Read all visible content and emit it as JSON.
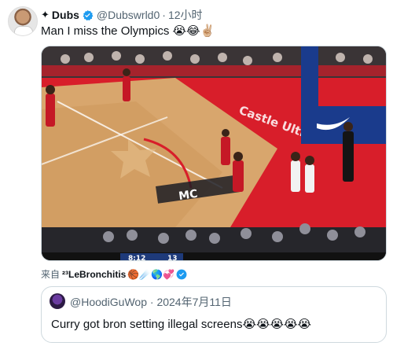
{
  "tweet": {
    "spark": "✦",
    "display_name": "Dubs",
    "handle": "@Dubswrld0",
    "separator": "·",
    "time": "12小时",
    "text": "Man I miss the Olympics 😭😂✌🏼"
  },
  "media": {
    "court_text": "Castle Ultra",
    "brand_text": "MC",
    "scoreboard": [
      "8:12",
      "13"
    ]
  },
  "source": {
    "prefix": "来自",
    "name": "²³LeBronchitis",
    "emojis": "🏀☄️🌎💞"
  },
  "quote": {
    "handle": "@HoodiGuWop",
    "separator": "·",
    "date": "2024年7月11日",
    "text": "Curry got bron setting illegal screens😭😭😭😭😭"
  },
  "colors": {
    "accent_blue": "#1d9bf0",
    "court_red": "#d81e2a",
    "wood": "#d8a66d"
  }
}
